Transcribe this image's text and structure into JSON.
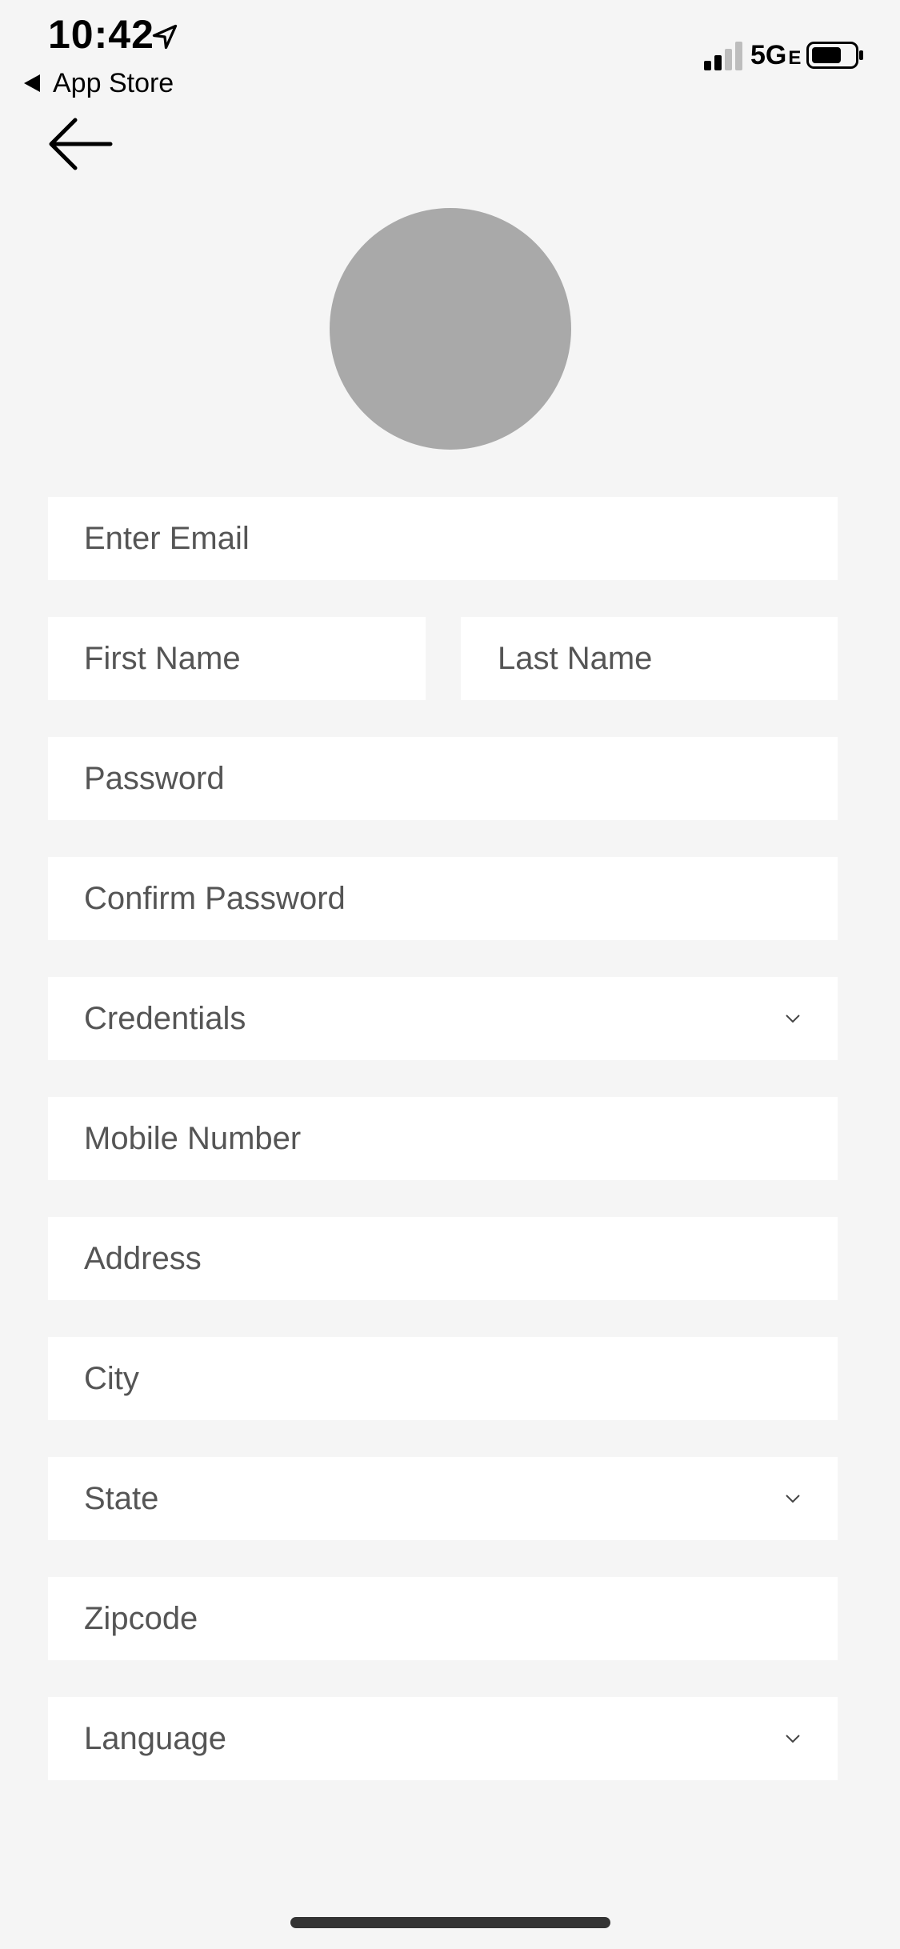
{
  "status_bar": {
    "time": "10:42",
    "back_app": "App Store",
    "network": "5G",
    "network_suffix": "E",
    "icons": [
      "location-arrow-icon",
      "back-triangle-icon",
      "signal-bars-icon",
      "battery-icon"
    ]
  },
  "nav": {
    "back_icon": "arrow-left-icon"
  },
  "profile": {
    "avatar_color": "#a9a9a9"
  },
  "form": {
    "email_placeholder": "Enter Email",
    "first_name_placeholder": "First Name",
    "last_name_placeholder": "Last Name",
    "password_placeholder": "Password",
    "confirm_password_placeholder": "Confirm Password",
    "credentials_label": "Credentials",
    "mobile_placeholder": "Mobile Number",
    "address_placeholder": "Address",
    "city_placeholder": "City",
    "state_label": "State",
    "zipcode_placeholder": "Zipcode",
    "language_label": "Language"
  },
  "colors": {
    "background": "#f5f5f5",
    "field_background": "#ffffff",
    "placeholder_text": "#555555"
  }
}
